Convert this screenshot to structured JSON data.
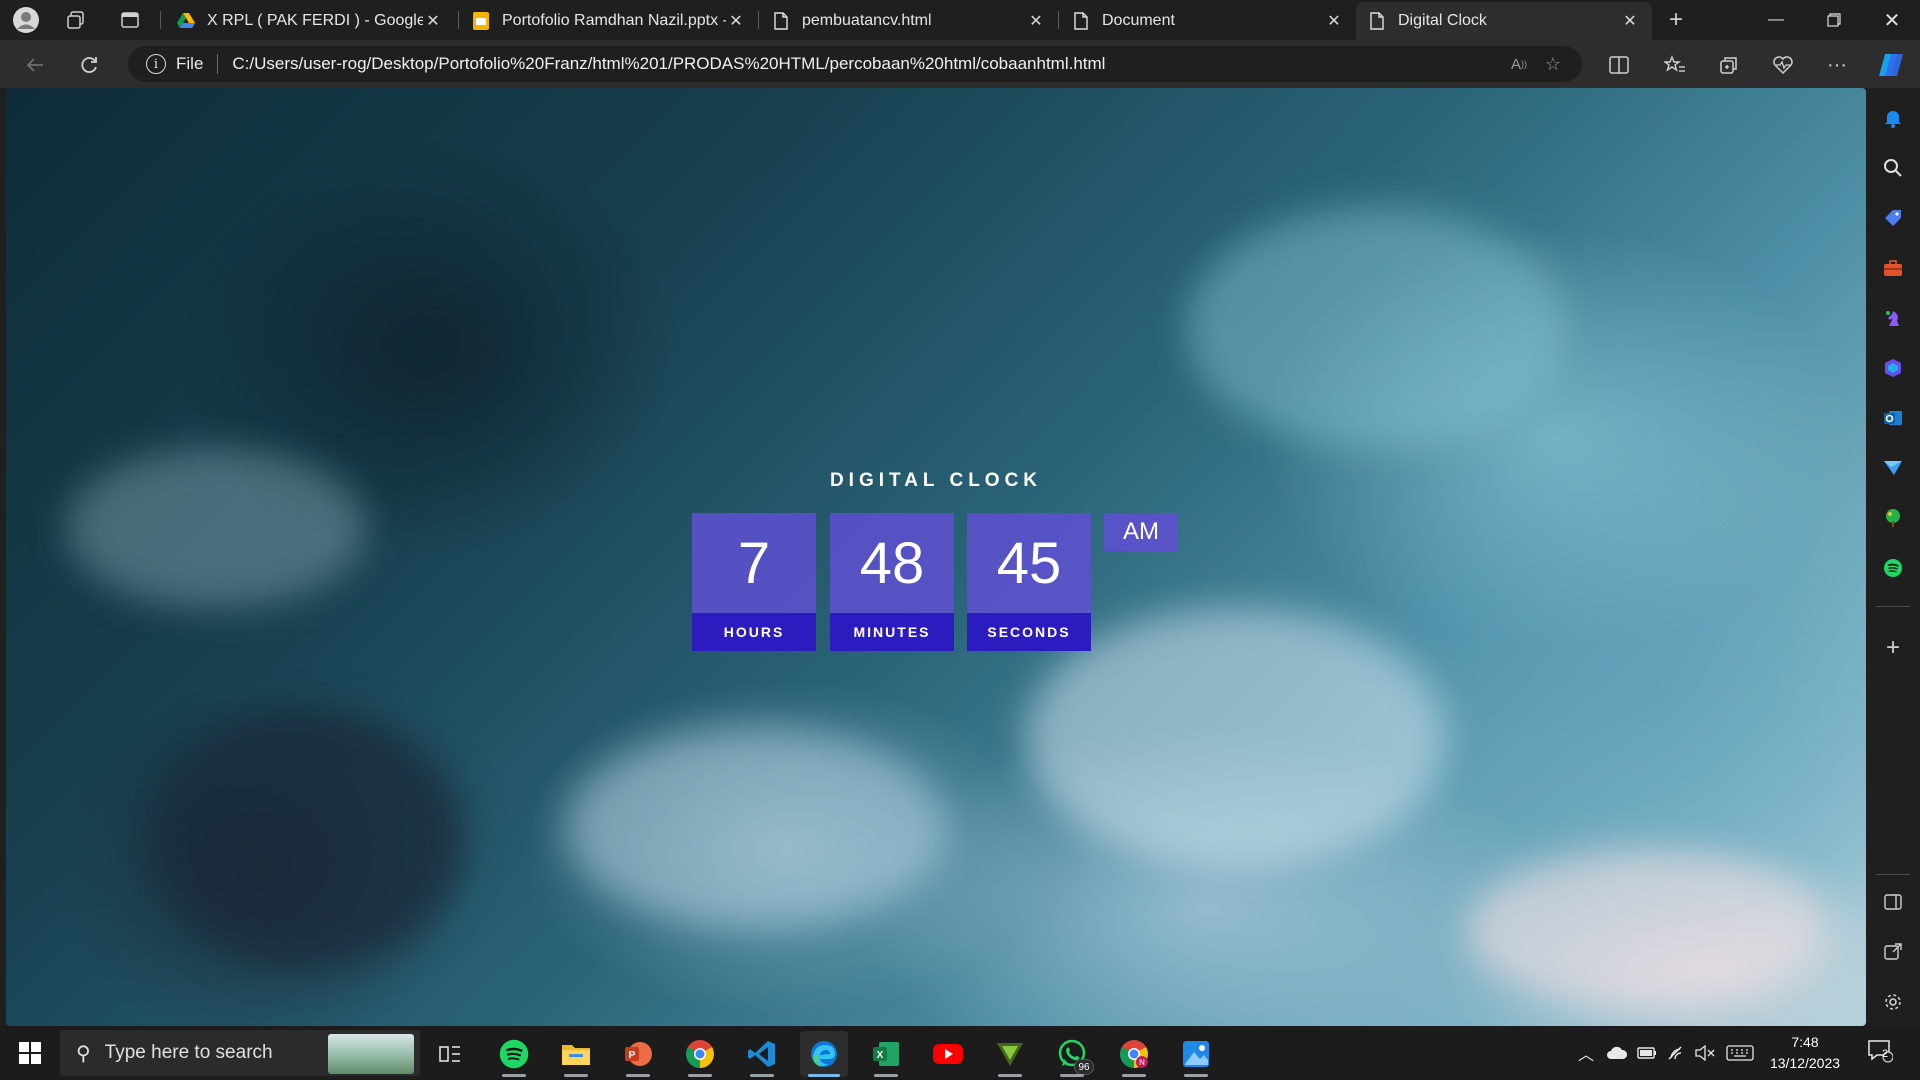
{
  "tabs": [
    {
      "label": "X RPL ( PAK FERDI ) - Google Drive",
      "icon": "google-drive-icon",
      "active": false
    },
    {
      "label": "Portofolio Ramdhan Nazil.pptx - Google Slides",
      "icon": "google-slides-icon",
      "active": false
    },
    {
      "label": "pembuatancv.html",
      "icon": "file-icon",
      "active": false
    },
    {
      "label": "Document",
      "icon": "file-icon",
      "active": false
    },
    {
      "label": "Digital Clock",
      "icon": "file-icon",
      "active": true
    }
  ],
  "address": {
    "protocol_label": "File",
    "url": "C:/Users/user-rog/Desktop/Portofolio%20Franz/html%201/PRODAS%20HTML/percobaan%20html/cobaanhtml.html"
  },
  "clock": {
    "title": "DIGITAL CLOCK",
    "hours": "7",
    "minutes": "48",
    "seconds": "45",
    "hours_label": "HOURS",
    "minutes_label": "MINUTES",
    "seconds_label": "SECONDS",
    "period": "AM",
    "box_color": "#5f50d2",
    "label_color": "#2c1cc0"
  },
  "taskbar": {
    "search_placeholder": "Type here to search",
    "apps": [
      {
        "name": "task-view-icon"
      },
      {
        "name": "spotify-icon"
      },
      {
        "name": "file-explorer-icon"
      },
      {
        "name": "powerpoint-icon"
      },
      {
        "name": "chrome-icon"
      },
      {
        "name": "vscode-icon"
      },
      {
        "name": "edge-icon"
      },
      {
        "name": "excel-icon"
      },
      {
        "name": "youtube-icon"
      },
      {
        "name": "vectorize-icon"
      },
      {
        "name": "whatsapp-icon",
        "badge": "96"
      },
      {
        "name": "chrome-profile-icon"
      },
      {
        "name": "photos-icon"
      }
    ],
    "time": "7:48",
    "date": "13/12/2023",
    "notification_count": "2"
  },
  "colors": {
    "accent_blue": "#76b9ed",
    "chrome_dark": "#1f1f1f",
    "toolbar": "#2d2d2d"
  }
}
